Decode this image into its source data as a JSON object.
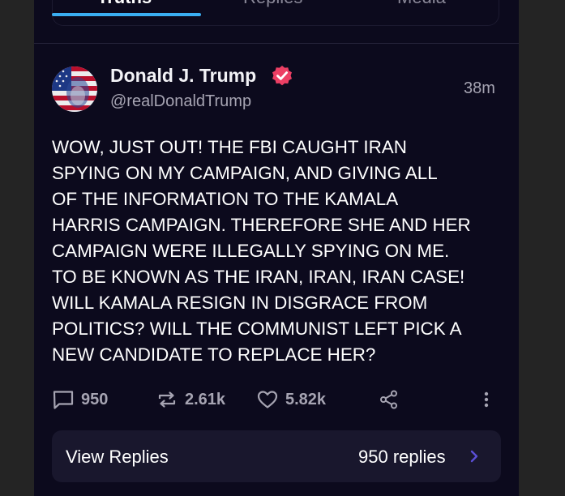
{
  "tabs": [
    {
      "label": "Truths",
      "active": true
    },
    {
      "label": "Replies",
      "active": false
    },
    {
      "label": "Media",
      "active": false
    }
  ],
  "post": {
    "author": {
      "display_name": "Donald J. Trump",
      "handle": "@realDonaldTrump",
      "verified": true,
      "avatar_icon": "avatar-flag-portrait"
    },
    "timestamp": "38m",
    "body_lines": [
      "WOW, JUST OUT! THE FBI CAUGHT IRAN",
      "SPYING ON MY CAMPAIGN, AND GIVING ALL",
      "OF THE INFORMATION TO THE KAMALA",
      "HARRIS CAMPAIGN. THEREFORE SHE AND HER",
      "CAMPAIGN WERE ILLEGALLY SPYING ON ME.",
      "TO BE KNOWN AS THE IRAN, IRAN, IRAN CASE!",
      "WILL KAMALA RESIGN IN DISGRACE FROM",
      "POLITICS? WILL THE COMMUNIST LEFT PICK A",
      "NEW CANDIDATE TO REPLACE HER?"
    ],
    "actions": {
      "replies": "950",
      "retruths": "2.61k",
      "likes": "5.82k"
    },
    "view_replies": {
      "label": "View Replies",
      "count_label": "950 replies"
    }
  },
  "colors": {
    "background": "#0c0a1d",
    "accent_underline": "#3aaef2",
    "verified_badge": "#ec3f64",
    "muted_text": "#a6a4b2",
    "card": "#19172d",
    "chevron": "#5b4fd6"
  }
}
